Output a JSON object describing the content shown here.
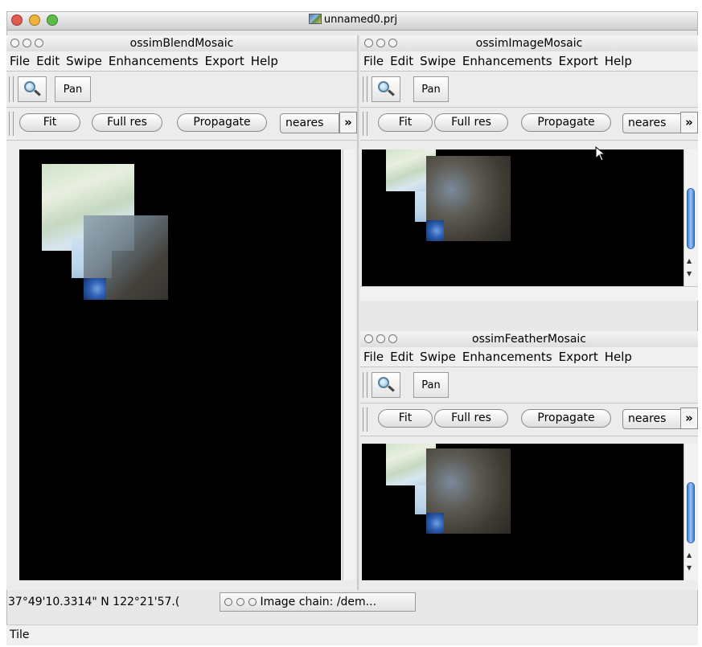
{
  "main_window": {
    "title": "unnamed0.prj",
    "traffic_colors": {
      "close": "#e35a4f",
      "minimize": "#f0b33b",
      "zoom": "#5bbc4a"
    }
  },
  "windows": [
    {
      "title": "ossimBlendMosaic",
      "menus": [
        "File",
        "Edit",
        "Swipe",
        "Enhancements",
        "Export",
        "Help"
      ],
      "pan_label": "Pan",
      "buttons": {
        "fit": "Fit",
        "full_res": "Full res",
        "propagate": "Propagate"
      },
      "resampler": "neares",
      "overflow": "»"
    },
    {
      "title": "ossimImageMosaic",
      "menus": [
        "File",
        "Edit",
        "Swipe",
        "Enhancements",
        "Export",
        "Help"
      ],
      "pan_label": "Pan",
      "buttons": {
        "fit": "Fit",
        "full_res": "Full res",
        "propagate": "Propagate"
      },
      "resampler": "neares",
      "overflow": "»"
    },
    {
      "title": "ossimFeatherMosaic",
      "menus": [
        "File",
        "Edit",
        "Swipe",
        "Enhancements",
        "Export",
        "Help"
      ],
      "pan_label": "Pan",
      "buttons": {
        "fit": "Fit",
        "full_res": "Full res",
        "propagate": "Propagate"
      },
      "resampler": "neares",
      "overflow": "»"
    }
  ],
  "icons": {
    "zoom_tool": "magnifier-icon",
    "overflow": "chevron-right-icon",
    "cursor": "arrow-cursor-icon"
  },
  "status": {
    "coordinates": "37°49'10.3314\" N 122°21'57.(",
    "image_chain": "Image chain: /dem...",
    "footer": "Tile"
  }
}
